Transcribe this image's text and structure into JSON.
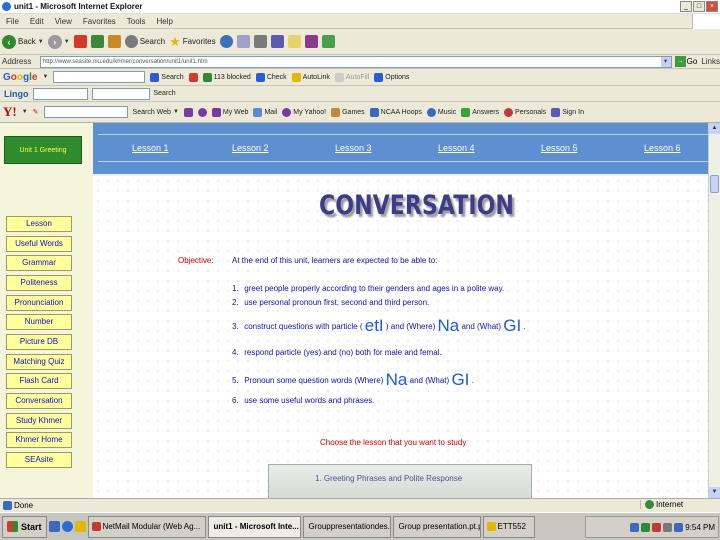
{
  "window": {
    "title": "unit1 - Microsoft Internet Explorer"
  },
  "menu": [
    "File",
    "Edit",
    "View",
    "Favorites",
    "Tools",
    "Help"
  ],
  "toolbar": {
    "back": "Back",
    "search": "Search",
    "favorites": "Favorites"
  },
  "address": {
    "label": "Address",
    "url": "http://www.seasite.niu.edu/khmer/conversation/unit1/unit1.htm",
    "go": "Go",
    "links": "Links"
  },
  "google": {
    "logo": "Google",
    "search": "Search",
    "blocked": "113 blocked",
    "check": "Check",
    "autolink": "AutoLink",
    "autofill": "AutoFill",
    "options": "Options"
  },
  "lingo": {
    "logo": "Lingo",
    "search": "Search"
  },
  "yahoo": {
    "logo": "Y!",
    "search_web": "Search Web",
    "my_web": "My Web",
    "mail": "Mail",
    "my_yahoo": "My Yahoo!",
    "games": "Games",
    "ncaa": "NCAA Hoops",
    "music": "Music",
    "answers": "Answers",
    "personals": "Personals",
    "signin": "Sign In"
  },
  "sidebar": {
    "unit_badge": "Unit 1 Greeting",
    "items": [
      "Lesson",
      "Useful Words",
      "Grammar",
      "Politeness",
      "Pronunciation",
      "Number",
      "Picture DB",
      "Matching Quiz",
      "Flash Card",
      "Conversation",
      "Study Khmer",
      "Khmer Home",
      "SEAsite"
    ]
  },
  "lessons": [
    "Lesson 1",
    "Lesson 2",
    "Lesson 3",
    "Lesson 4",
    "Lesson 5",
    "Lesson 6"
  ],
  "content": {
    "heading": "CONVERSATION",
    "objective_label": "Objective:",
    "objective_text": "At the end of this unit, learners are expected to be able to:",
    "items": [
      {
        "num": "1.",
        "text": "greet people properly according to their genders and ages in a polite way."
      },
      {
        "num": "2.",
        "text": "use personal pronoun first, second and third person."
      },
      {
        "num": "3.",
        "a": "construct questions with particle (",
        "b": "etI",
        "c": ") and (Where)",
        "d": "Na",
        "e": "and (What)",
        "f": "GI",
        "g": "."
      },
      {
        "num": "4.",
        "text": "respond particle (yes) and (no) both for male and femal."
      },
      {
        "num": "5.",
        "a": "Pronoun some question words (Where)",
        "b": "Na",
        "c": "and (What)",
        "d": "GI",
        "e": "."
      },
      {
        "num": "6.",
        "text": "use some useful words and phrases."
      }
    ],
    "choose": "Choose the lesson that you want to study",
    "lesson_caption": "1. Greeting Phrases and Polite Response"
  },
  "status": {
    "done": "Done",
    "zone": "Internet"
  },
  "taskbar": {
    "start": "Start",
    "tasks": [
      "NetMail Modular (Web Ag...",
      "unit1 - Microsoft Inte...",
      "Grouppresentationdes.ppt",
      "Group presentation.pt.ppt",
      "ETT552"
    ],
    "clock": "9:54 PM"
  },
  "colors": {
    "lessonBar": "#5d8fd1",
    "navButton": "#ffff9c",
    "unitBadge": "#2e8b2e",
    "heading": "#3c3c8c",
    "objectiveLabel": "#cc0000",
    "bodyText": "#1212a8"
  }
}
